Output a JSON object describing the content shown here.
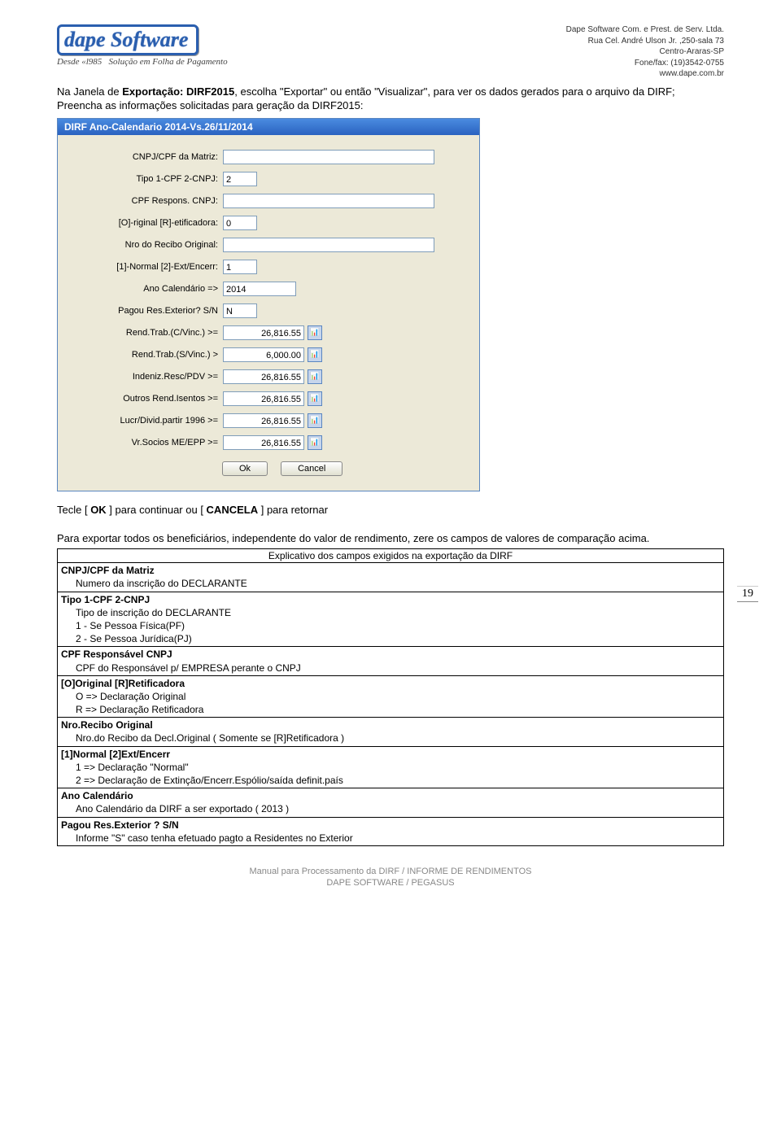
{
  "header": {
    "logo_main": "dape Software",
    "logo_since": "Desde «l985",
    "logo_tag": "Solução em Folha de Pagamento",
    "company": [
      "Dape Software Com. e Prest. de Serv. Ltda.",
      "Rua Cel. André Ulson Jr. ,250-sala 73",
      "Centro-Araras-SP",
      "Fone/fax: (19)3542-0755",
      "www.dape.com.br"
    ]
  },
  "intro": {
    "l1a": "Na Janela de ",
    "l1b": "Exportação: DIRF2015",
    "l1c": ", escolha \"Exportar\" ou então \"Visualizar\", para ver os dados gerados para o arquivo da DIRF;",
    "l2": "Preencha as informações solicitadas para geração da DIRF2015:"
  },
  "dialog": {
    "title": "DIRF Ano-Calendario 2014-Vs.26/11/2014",
    "fields": {
      "cnpj_cpf_label": "CNPJ/CPF da Matriz:",
      "cnpj_cpf_val": "",
      "tipo_label": "Tipo 1-CPF 2-CNPJ:",
      "tipo_val": "2",
      "cpf_resp_label": "CPF Respons. CNPJ:",
      "cpf_resp_val": "",
      "orig_label": "[O]-riginal [R]-etificadora:",
      "orig_val": "0",
      "recibo_label": "Nro do Recibo Original:",
      "recibo_val": "",
      "normal_label": "[1]-Normal [2]-Ext/Encerr:",
      "normal_val": "1",
      "ano_label": "Ano Calendário =>",
      "ano_val": "2014",
      "pagou_label": "Pagou Res.Exterior? S/N",
      "pagou_val": "N",
      "rend_cv_label": "Rend.Trab.(C/Vinc.) >=",
      "rend_cv_val": "26,816.55",
      "rend_sv_label": "Rend.Trab.(S/Vinc.) >",
      "rend_sv_val": "6,000.00",
      "indeniz_label": "Indeniz.Resc/PDV >=",
      "indeniz_val": "26,816.55",
      "outros_label": "Outros Rend.Isentos >=",
      "outros_val": "26,816.55",
      "lucro_label": "Lucr/Divid.partir 1996 >=",
      "lucro_val": "26,816.55",
      "socios_label": "Vr.Socios ME/EPP >=",
      "socios_val": "26,816.55"
    },
    "ok": "Ok",
    "cancel": "Cancel"
  },
  "page_number": "19",
  "mid": {
    "l1a": "Tecle [ ",
    "l1b": "OK",
    "l1c": " ] para continuar ou [ ",
    "l1d": "CANCELA",
    "l1e": " ] para retornar",
    "l2": "Para exportar todos os beneficiários, independente do valor de rendimento, zere os campos de valores de comparação acima."
  },
  "table": {
    "title": "Explicativo dos campos exigidos na exportação da DIRF",
    "items": [
      {
        "head": "CNPJ/CPF da Matriz",
        "lines": [
          "Numero da inscrição do DECLARANTE"
        ]
      },
      {
        "head": "Tipo 1-CPF 2-CNPJ",
        "lines": [
          "Tipo de inscrição do DECLARANTE",
          "1 - Se Pessoa Física(PF)",
          "2 - Se Pessoa Jurídica(PJ)"
        ]
      },
      {
        "head": "CPF Responsável CNPJ",
        "lines": [
          "CPF do Responsável p/ EMPRESA perante o CNPJ"
        ]
      },
      {
        "head": "[O]Original [R]Retificadora",
        "lines": [
          "O => Declaração Original",
          "R => Declaração Retificadora"
        ]
      },
      {
        "head": "Nro.Recibo Original",
        "lines": [
          "Nro.do Recibo da Decl.Original ( Somente se [R]Retificadora )"
        ]
      },
      {
        "head": "[1]Normal [2]Ext/Encerr",
        "lines": [
          "1 => Declaração \"Normal\"",
          "2 => Declaração de Extinção/Encerr.Espólio/saída definit.país"
        ]
      },
      {
        "head": "Ano Calendário",
        "lines": [
          "Ano Calendário da DIRF a ser exportado ( 2013 )"
        ]
      },
      {
        "head": "Pagou Res.Exterior ? S/N",
        "lines": [
          "Informe \"S\" caso tenha efetuado pagto a Residentes no Exterior"
        ]
      }
    ]
  },
  "footer": {
    "l1": "Manual para Processamento da DIRF / INFORME DE RENDIMENTOS",
    "l2": "DAPE SOFTWARE / PEGASUS"
  }
}
